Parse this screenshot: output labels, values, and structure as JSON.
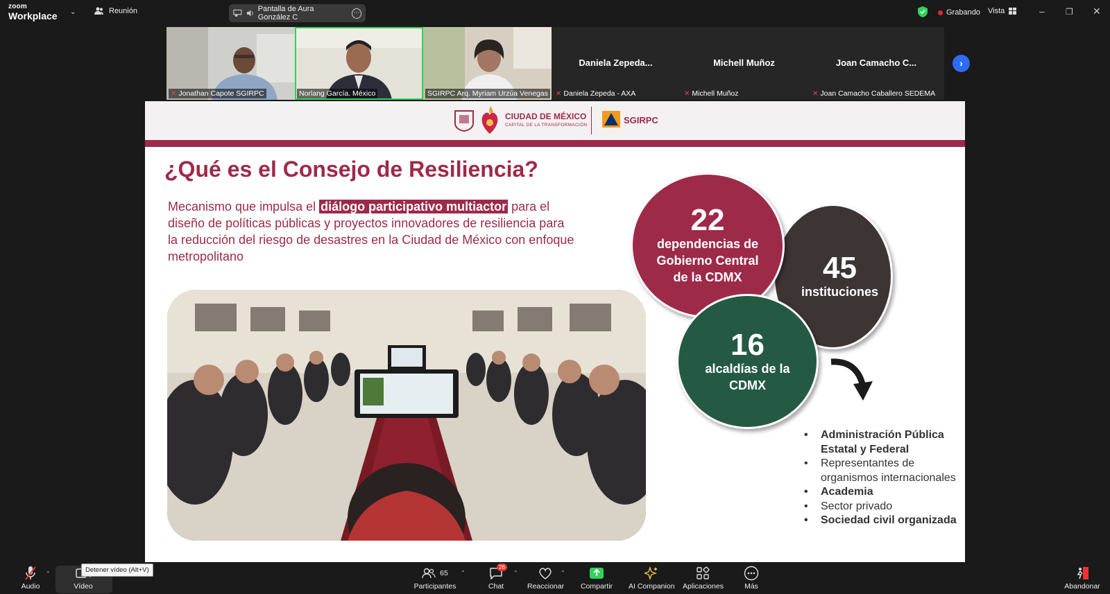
{
  "app": {
    "logo_top": "zoom",
    "logo_bottom": "Workplace",
    "meeting_label": "Reunión"
  },
  "share": {
    "label": "Pantalla de Aura González C"
  },
  "status": {
    "recording": "Grabando",
    "view": "Vista"
  },
  "gallery": {
    "tiles": [
      {
        "name": "Jonathan Capote SGIRPC",
        "has_video": true
      },
      {
        "name": "Norlang García. México",
        "has_video": true
      },
      {
        "name": "SGIRPC Arq. Myriam Urzúa Venegas",
        "has_video": true
      },
      {
        "name": "Daniela Zepeda - AXA",
        "display": "Daniela  Zepeda...",
        "has_video": false
      },
      {
        "name": "Michell Muñoz",
        "display": "Michell Muñoz",
        "has_video": false
      },
      {
        "name": "Joan Camacho Caballero SEDEMA",
        "display": "Joan  Camacho  C...",
        "has_video": false
      }
    ]
  },
  "slide": {
    "brand_title": "CIUDAD DE MÉXICO",
    "brand_subtitle": "CAPITAL DE LA TRANSFORMACIÓN",
    "brand_org": "SGIRPC",
    "title": "¿Qué es el Consejo de Resiliencia?",
    "lead_before": "Mecanismo que impulsa el ",
    "lead_highlight": "diálogo participativo multiactor",
    "lead_after": " para el diseño de políticas públicas y proyectos innovadores de resiliencia para la reducción del riesgo de desastres en la Ciudad de México con enfoque metropolitano",
    "circles": [
      {
        "number": "22",
        "label_lines": [
          "dependencias de",
          "Gobierno Central",
          "de la CDMX"
        ],
        "color": "#9e2a4a"
      },
      {
        "number": "45",
        "label_lines": [
          "instituciones"
        ],
        "color": "#3c3534"
      },
      {
        "number": "16",
        "label_lines": [
          "alcaldías de la",
          "CDMX"
        ],
        "color": "#245a44"
      }
    ],
    "bullets": [
      {
        "text": "Administración Pública Estatal y Federal",
        "bold": true
      },
      {
        "text": "Representantes de organismos internacionales",
        "bold": false
      },
      {
        "text": "Academia",
        "bold": true
      },
      {
        "text": "Sector privado",
        "bold": false
      },
      {
        "text": "Sociedad civil organizada",
        "bold": true
      }
    ]
  },
  "toolbar": {
    "audio": "Audio",
    "video": "Vídeo",
    "video_tooltip": "Detener vídeo (Alt+V)",
    "participants": "Participantes",
    "participants_count": "65",
    "chat": "Chat",
    "chat_badge": "26",
    "react": "Reaccionar",
    "share": "Compartir",
    "ai": "AI Companion",
    "apps": "Aplicaciones",
    "more": "Más",
    "leave": "Abandonar"
  },
  "colors": {
    "accent_share": "#2fd35a",
    "brand": "#9e2a4a",
    "recording": "#e02828",
    "next": "#2d6cf5"
  }
}
